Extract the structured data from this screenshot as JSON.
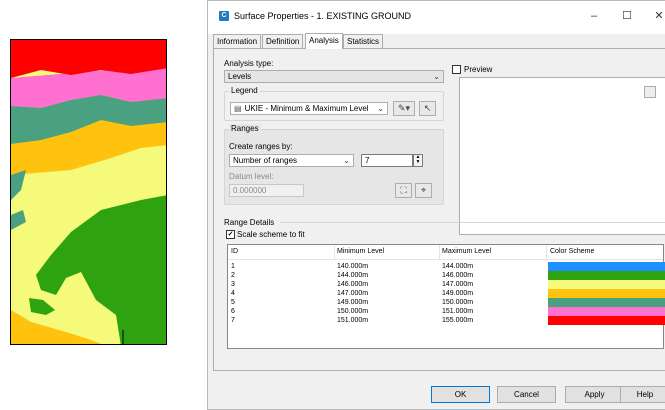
{
  "window": {
    "title": "Surface Properties - 1. EXISTING GROUND",
    "minimize": "–",
    "maximize": "☐",
    "close": "✕",
    "app_icon": "C"
  },
  "tabs": [
    {
      "label": "Information"
    },
    {
      "label": "Definition"
    },
    {
      "label": "Analysis"
    },
    {
      "label": "Statistics"
    }
  ],
  "analysis": {
    "type_label": "Analysis type:",
    "type_value": "Levels",
    "preview_label": "Preview",
    "legend_label": "Legend",
    "legend_value": "UKIE - Minimum & Maximum Level",
    "ranges_label": "Ranges",
    "create_by_label": "Create ranges by:",
    "create_by_value": "Number of ranges",
    "range_count": "7",
    "datum_label": "Datum level:",
    "datum_value": "0.000000"
  },
  "range_details": {
    "label": "Range Details",
    "scale_label": "Scale scheme to fit",
    "headers": {
      "id": "ID",
      "min": "Minimum Level",
      "max": "Maximum Level",
      "scheme": "Color Scheme"
    },
    "rows": [
      {
        "id": "1",
        "min": "140.000m",
        "max": "144.000m",
        "color": "#1e90ff"
      },
      {
        "id": "2",
        "min": "144.000m",
        "max": "146.000m",
        "color": "#2ea30f"
      },
      {
        "id": "3",
        "min": "146.000m",
        "max": "147.000m",
        "color": "#f5fa7a"
      },
      {
        "id": "4",
        "min": "147.000m",
        "max": "149.000m",
        "color": "#ffc20e"
      },
      {
        "id": "5",
        "min": "149.000m",
        "max": "150.000m",
        "color": "#4aa181"
      },
      {
        "id": "6",
        "min": "150.000m",
        "max": "151.000m",
        "color": "#ff70d0"
      },
      {
        "id": "7",
        "min": "151.000m",
        "max": "155.000m",
        "color": "#ff0000"
      }
    ]
  },
  "buttons": {
    "ok": "OK",
    "cancel": "Cancel",
    "apply": "Apply",
    "help": "Help"
  },
  "icons": {
    "legend_icon": "style-list-icon",
    "edit_style": "edit-style-icon",
    "pick_style": "pick-style-icon",
    "datum_pick": "pick-datum-icon",
    "datum_match": "match-icon"
  }
}
